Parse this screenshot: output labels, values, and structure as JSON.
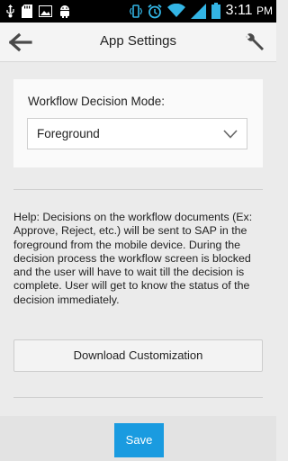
{
  "status_bar": {
    "time": "3:11",
    "time_suffix": "PM",
    "icons": [
      "usb-icon",
      "sd-card-icon",
      "image-icon",
      "android-icon",
      "vibrate-icon",
      "alarm-icon",
      "wifi-icon",
      "signal-icon",
      "battery-icon"
    ]
  },
  "action_bar": {
    "title": "App Settings",
    "back_icon": "back-arrow-icon",
    "settings_icon": "wrench-icon"
  },
  "settings": {
    "mode_label": "Workflow Decision Mode:",
    "mode_value": "Foreground"
  },
  "help_text": "Help: Decisions on the workflow documents (Ex: Approve, Reject, etc.) will be sent to SAP in the foreground from the mobile device. During the decision process the workflow screen is blocked and the user will have to wait till the decision is complete. User will get to know the status of the decision immediately.",
  "download_button": "Download Customization",
  "save_button": "Save",
  "colors": {
    "accent": "#1a9be0",
    "status_icons": "#33b5e5",
    "background": "#ebebeb"
  }
}
